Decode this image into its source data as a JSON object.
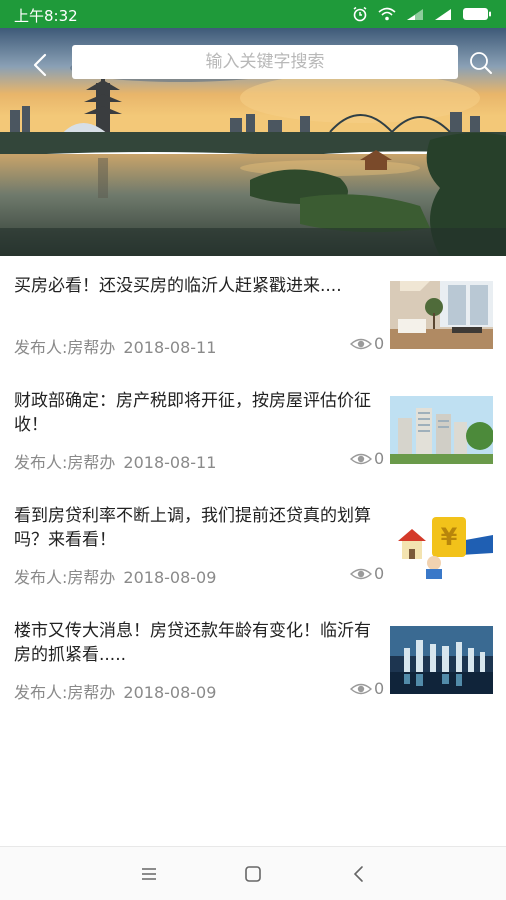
{
  "status_bar": {
    "time": "上午8:32",
    "icons": [
      "alarm-icon",
      "wifi-icon",
      "signal-icon",
      "signal-icon",
      "battery-icon"
    ]
  },
  "header": {
    "search_placeholder": "输入关键字搜索",
    "back_icon": "back-arrow-icon",
    "search_icon": "search-icon"
  },
  "news": [
    {
      "title": "买房必看！还没买房的临沂人赶紧戳进来....",
      "publisher": "发布人:房帮办",
      "date": "2018-08-11",
      "views": "0",
      "thumb": "interior-room"
    },
    {
      "title": "财政部确定：房产税即将开征，按房屋评估价征收！",
      "publisher": "发布人:房帮办",
      "date": "2018-08-11",
      "views": "0",
      "thumb": "apartment-buildings"
    },
    {
      "title": "看到房贷利率不断上调，我们提前还贷真的划算吗？来看看！",
      "publisher": "发布人:房帮办",
      "date": "2018-08-09",
      "views": "0",
      "thumb": "house-loan-cartoon"
    },
    {
      "title": "楼市又传大消息！房贷还款年龄有变化！临沂有房的抓紧看.....",
      "publisher": "发布人:房帮办",
      "date": "2018-08-09",
      "views": "0",
      "thumb": "city-night-skyline"
    }
  ],
  "nav_bar": {
    "icons": [
      "menu-icon",
      "home-square-icon",
      "back-triangle-icon"
    ]
  },
  "colors": {
    "status_bar": "#1f9a3a",
    "title_text": "#222222",
    "meta_text": "#8a8a8a"
  }
}
